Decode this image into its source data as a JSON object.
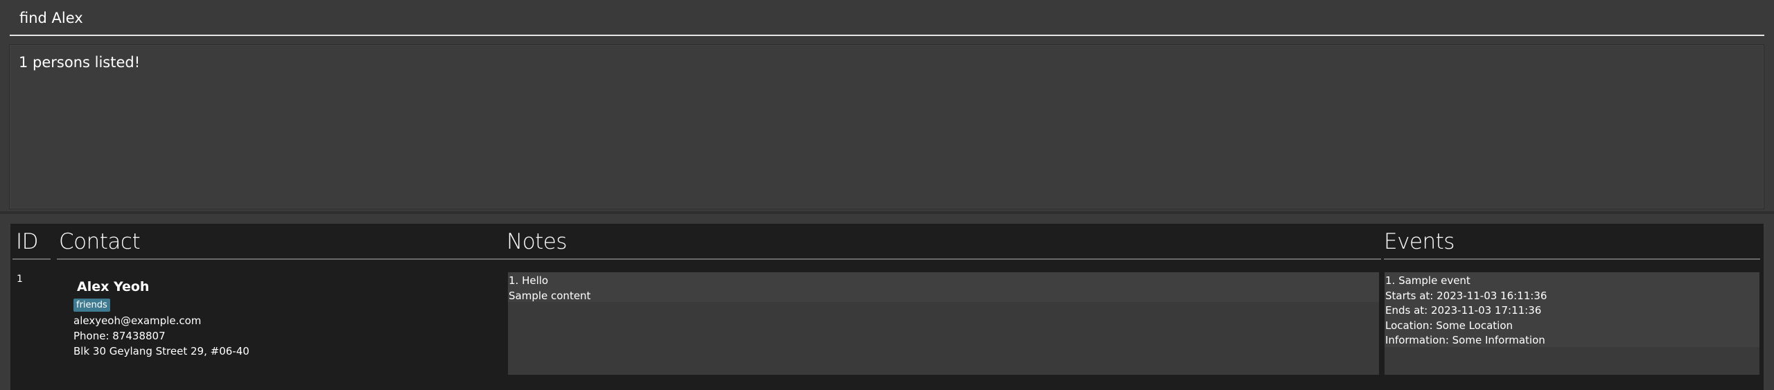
{
  "command": {
    "value": "find Alex"
  },
  "result": {
    "message": "1 persons listed!"
  },
  "list": {
    "headers": {
      "id": "ID",
      "contact": "Contact",
      "notes": "Notes",
      "events": "Events"
    },
    "persons": [
      {
        "id": "1",
        "name": "Alex Yeoh",
        "tags": [
          "friends"
        ],
        "email": "alexyeoh@example.com",
        "phone": "Phone: 87438807",
        "address": "Blk 30 Geylang Street 29, #06-40",
        "notes": [
          {
            "title": "1. Hello",
            "content": "Sample content"
          }
        ],
        "events": [
          {
            "title": "1. Sample event",
            "starts": "Starts at: 2023-11-03 16:11:36",
            "ends": "Ends at: 2023-11-03 17:11:36",
            "location": "Location: Some Location",
            "information": "Information: Some Information"
          }
        ]
      }
    ]
  },
  "colors": {
    "background": "#3a3a3a",
    "list_background": "#1d1d1d",
    "tag": "#3e7b91",
    "text": "#ffffff"
  }
}
